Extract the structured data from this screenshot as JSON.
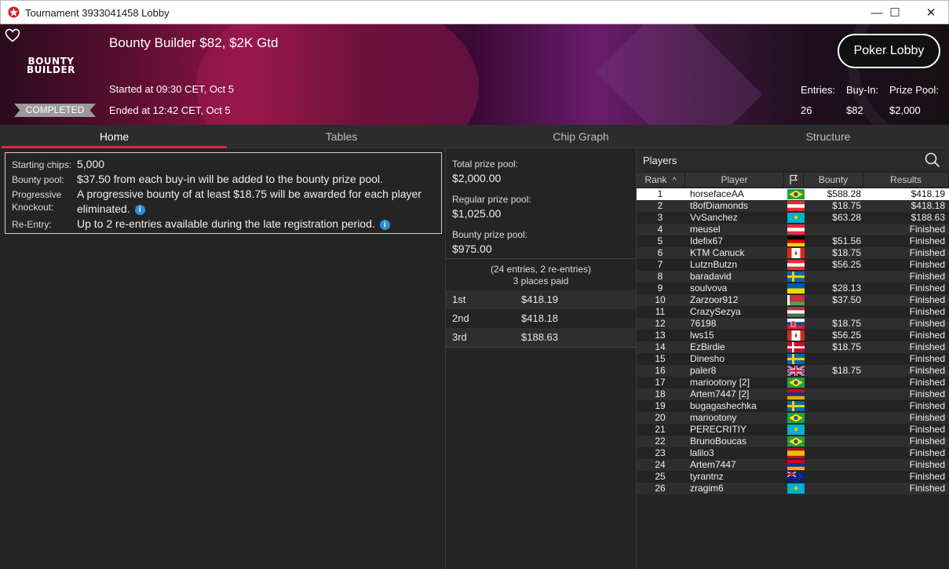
{
  "window": {
    "title": "Tournament 3933041458 Lobby",
    "controls": {
      "minimize": "—",
      "maximize": "☐",
      "close": "✕"
    }
  },
  "header": {
    "logo_line1": "BOUNTY",
    "logo_line2": "BUILDER",
    "tournament_name": "Bounty Builder $82, $2K Gtd",
    "started": "Started at 09:30 CET, Oct 5",
    "ended": "Ended at 12:42 CET, Oct 5",
    "status": "COMPLETED",
    "lobby_button": "Poker Lobby",
    "stats": [
      {
        "label": "Entries:",
        "value": "26"
      },
      {
        "label": "Buy-In:",
        "value": "$82"
      },
      {
        "label": "Prize Pool:",
        "value": "$2,000"
      }
    ]
  },
  "tabs": [
    "Home",
    "Tables",
    "Chip Graph",
    "Structure"
  ],
  "info": {
    "starting_chips_label": "Starting chips:",
    "starting_chips": "5,000",
    "bounty_pool_label": "Bounty pool:",
    "bounty_pool": "$37.50 from each buy-in will be added to the bounty prize pool.",
    "pko_label_1": "Progressive",
    "pko_label_2": "Knockout:",
    "pko_line1": "A progressive bounty of at least $18.75 will be awarded for each player",
    "pko_line2": "eliminated.",
    "reentry_label": "Re-Entry:",
    "reentry": "Up to 2 re-entries available during the late registration period."
  },
  "prizes": {
    "total_label": "Total prize pool:",
    "total": "$2,000.00",
    "regular_label": "Regular prize pool:",
    "regular": "$1,025.00",
    "bounty_label": "Bounty prize pool:",
    "bounty": "$975.00",
    "entries_note": "(24 entries, 2 re-entries)",
    "places_paid": "3 places paid",
    "places": [
      {
        "place": "1st",
        "amount": "$418.19"
      },
      {
        "place": "2nd",
        "amount": "$418.18"
      },
      {
        "place": "3rd",
        "amount": "$188.63"
      }
    ]
  },
  "players": {
    "title": "Players",
    "columns": {
      "rank": "Rank",
      "player": "Player",
      "bounty": "Bounty",
      "results": "Results"
    },
    "rows": [
      {
        "rank": "1",
        "name": "horsefaceAA",
        "flag": "brazil",
        "bounty": "$588.28",
        "result": "$418.19"
      },
      {
        "rank": "2",
        "name": "t8ofDiamonds",
        "flag": "austria",
        "bounty": "$18.75",
        "result": "$418.18"
      },
      {
        "rank": "3",
        "name": "VvSanchez",
        "flag": "kazakhstan",
        "bounty": "$63.28",
        "result": "$188.63"
      },
      {
        "rank": "4",
        "name": "meusel",
        "flag": "austria",
        "bounty": "",
        "result": "Finished"
      },
      {
        "rank": "5",
        "name": "Idefix67",
        "flag": "germany",
        "bounty": "$51.56",
        "result": "Finished"
      },
      {
        "rank": "6",
        "name": "KTM Canuck",
        "flag": "canada",
        "bounty": "$18.75",
        "result": "Finished"
      },
      {
        "rank": "7",
        "name": "LutznButzn",
        "flag": "austria",
        "bounty": "$56.25",
        "result": "Finished"
      },
      {
        "rank": "8",
        "name": "baradavid",
        "flag": "sweden",
        "bounty": "",
        "result": "Finished"
      },
      {
        "rank": "9",
        "name": "soulvova",
        "flag": "ukraine",
        "bounty": "$28.13",
        "result": "Finished"
      },
      {
        "rank": "10",
        "name": "Zarzoor912",
        "flag": "belarus",
        "bounty": "$37.50",
        "result": "Finished"
      },
      {
        "rank": "11",
        "name": "CrazySezya",
        "flag": "hungary",
        "bounty": "",
        "result": "Finished"
      },
      {
        "rank": "12",
        "name": "76198",
        "flag": "slovakia",
        "bounty": "$18.75",
        "result": "Finished"
      },
      {
        "rank": "13",
        "name": "lws15",
        "flag": "canada",
        "bounty": "$56.25",
        "result": "Finished"
      },
      {
        "rank": "14",
        "name": "EzBirdie",
        "flag": "denmark",
        "bounty": "$18.75",
        "result": "Finished"
      },
      {
        "rank": "15",
        "name": "Dinesho",
        "flag": "sweden",
        "bounty": "",
        "result": "Finished"
      },
      {
        "rank": "16",
        "name": "paler8",
        "flag": "uk",
        "bounty": "$18.75",
        "result": "Finished"
      },
      {
        "rank": "17",
        "name": "mariootony [2]",
        "flag": "brazil",
        "bounty": "",
        "result": "Finished"
      },
      {
        "rank": "18",
        "name": "Artem7447 [2]",
        "flag": "armenia",
        "bounty": "",
        "result": "Finished"
      },
      {
        "rank": "19",
        "name": "bugagashechka",
        "flag": "sweden",
        "bounty": "",
        "result": "Finished"
      },
      {
        "rank": "20",
        "name": "mariootony",
        "flag": "brazil",
        "bounty": "",
        "result": "Finished"
      },
      {
        "rank": "21",
        "name": "PERECRITIY",
        "flag": "kazakhstan",
        "bounty": "",
        "result": "Finished"
      },
      {
        "rank": "22",
        "name": "BrunoBoucas",
        "flag": "brazil",
        "bounty": "",
        "result": "Finished"
      },
      {
        "rank": "23",
        "name": "lalilo3",
        "flag": "spain",
        "bounty": "",
        "result": "Finished"
      },
      {
        "rank": "24",
        "name": "Artem7447",
        "flag": "armenia",
        "bounty": "",
        "result": "Finished"
      },
      {
        "rank": "25",
        "name": "tyrantnz",
        "flag": "newzealand",
        "bounty": "",
        "result": "Finished"
      },
      {
        "rank": "26",
        "name": "zragim6",
        "flag": "kazakhstan",
        "bounty": "",
        "result": "Finished"
      }
    ]
  },
  "colors": {
    "accent": "#e0283c",
    "background": "#242424",
    "info_icon": "#2e8fd6"
  }
}
